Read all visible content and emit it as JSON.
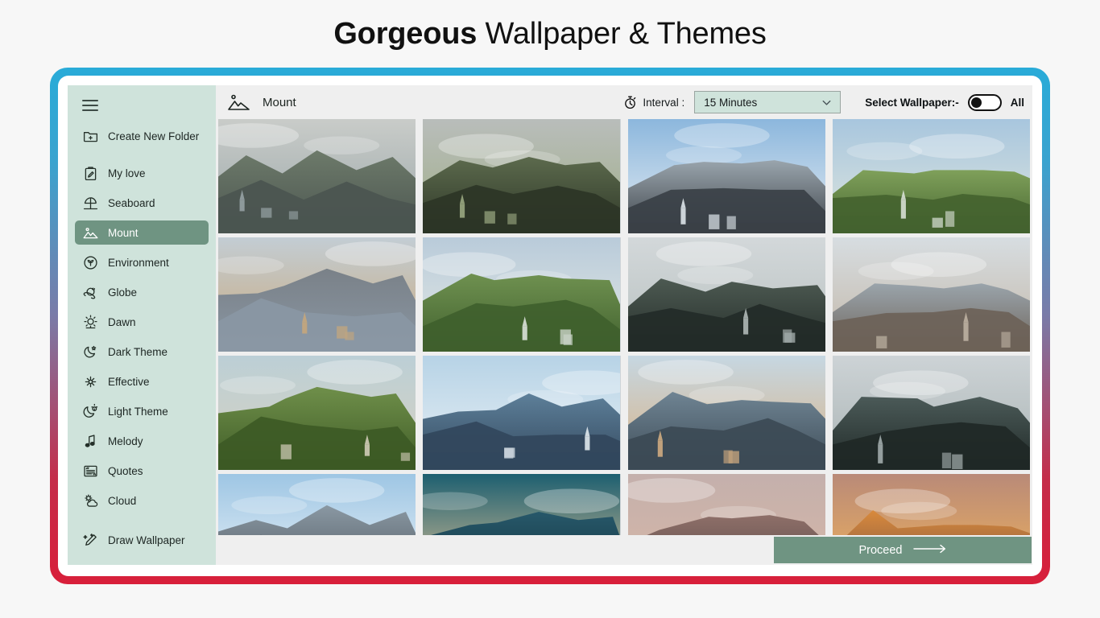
{
  "banner": {
    "title_strong": "Gorgeous",
    "title_light": " Wallpaper & Themes"
  },
  "sidebar": {
    "menu_icon": "hamburger-icon",
    "items": [
      {
        "label": "Create New Folder",
        "icon": "folder-plus-icon",
        "active": false
      },
      {
        "label": "My love",
        "icon": "clipboard-pencil-icon",
        "active": false
      },
      {
        "label": "Seaboard",
        "icon": "beach-umbrella-icon",
        "active": false
      },
      {
        "label": "Mount",
        "icon": "mountain-icon",
        "active": true
      },
      {
        "label": "Environment",
        "icon": "leaf-circle-icon",
        "active": false
      },
      {
        "label": "Globe",
        "icon": "planet-icon",
        "active": false
      },
      {
        "label": "Dawn",
        "icon": "sunrise-icon",
        "active": false
      },
      {
        "label": "Dark Theme",
        "icon": "moon-star-icon",
        "active": false
      },
      {
        "label": "Effective",
        "icon": "flower-icon",
        "active": false
      },
      {
        "label": "Light Theme",
        "icon": "moon-sun-icon",
        "active": false
      },
      {
        "label": "Melody",
        "icon": "music-note-icon",
        "active": false
      },
      {
        "label": "Quotes",
        "icon": "quote-card-icon",
        "active": false
      },
      {
        "label": "Cloud",
        "icon": "cloud-sun-icon",
        "active": false
      },
      {
        "label": "Draw Wallpaper",
        "icon": "pencil-sparkle-icon",
        "active": false
      }
    ]
  },
  "toolbar": {
    "category_icon": "mountain-icon",
    "category_title": "Mount",
    "interval_icon": "stopwatch-icon",
    "interval_label": "Interval :",
    "interval_value": "15 Minutes",
    "interval_chevron": "chevron-down-icon",
    "select_wallpaper_label": "Select Wallpaper:-",
    "toggle_state": "off",
    "toggle_all_label": "All"
  },
  "grid": {
    "tiles": [
      {
        "name": "fjord-ridge-cliffs",
        "sky": "#c9ccc9",
        "mid": "#6d7a6a",
        "fg": "#4b5550",
        "accent": "#9aa6a8"
      },
      {
        "name": "valley-lake-overcast",
        "sky": "#b9bdbb",
        "mid": "#5c6a4d",
        "fg": "#2c3526",
        "accent": "#9fae86"
      },
      {
        "name": "snow-peaks-blue-sky",
        "sky": "#8cb7dd",
        "mid": "#9aa5ad",
        "fg": "#3a4046",
        "accent": "#e6edf2"
      },
      {
        "name": "church-green-foliage",
        "sky": "#a8c6de",
        "mid": "#7fa05a",
        "fg": "#44632f",
        "accent": "#dfe6dd"
      },
      {
        "name": "lakeside-village-dusk",
        "sky": "#c3cdd4",
        "mid": "#7a8188",
        "fg": "#8a97a4",
        "accent": "#c9a87a"
      },
      {
        "name": "church-lake-greens",
        "sky": "#b9cbda",
        "mid": "#6f9150",
        "fg": "#3f5f2d",
        "accent": "#e4e9e4"
      },
      {
        "name": "misty-mountain-village",
        "sky": "#d3d8da",
        "mid": "#4d5a52",
        "fg": "#232b28",
        "accent": "#b7c0bf"
      },
      {
        "name": "snowy-town-hillside",
        "sky": "#d7dde1",
        "mid": "#9aa4ab",
        "fg": "#6d6258",
        "accent": "#c2b6a6"
      },
      {
        "name": "green-valley-farmhouse",
        "sky": "#bccfd6",
        "mid": "#6f8f4a",
        "fg": "#3d5a25",
        "accent": "#d8d2bf"
      },
      {
        "name": "alpine-lake-spire-blue",
        "sky": "#b7d3e6",
        "mid": "#5d7f99",
        "fg": "#32475c",
        "accent": "#e8f0f5"
      },
      {
        "name": "lakeside-church-winter",
        "sky": "#c6d7e2",
        "mid": "#6f8493",
        "fg": "#3c4a55",
        "accent": "#d9b183"
      },
      {
        "name": "foggy-village-dark",
        "sky": "#cdd3d6",
        "mid": "#4b5a58",
        "fg": "#1f2826",
        "accent": "#a9b3b3"
      },
      {
        "name": "snow-ridge-bright",
        "sky": "#9ec6e4",
        "mid": "#8a98a3",
        "fg": "#4a5259",
        "accent": "#eef4f8"
      },
      {
        "name": "teal-sky-spire",
        "sky": "#1d5f70",
        "mid": "#27586a",
        "fg": "#12303a",
        "accent": "#e8c89a"
      },
      {
        "name": "pink-rock-mountain",
        "sky": "#c4b0ac",
        "mid": "#8e6f69",
        "fg": "#4f4440",
        "accent": "#d8b7a6"
      },
      {
        "name": "sunset-orange-clouds",
        "sky": "#b98a78",
        "mid": "#d98a3c",
        "fg": "#6b4a46",
        "accent": "#f4b55a"
      }
    ],
    "proceed_label": "Proceed",
    "proceed_icon": "arrow-right-icon"
  },
  "colors": {
    "frame_top": "#29abd8",
    "frame_bottom": "#d81f3a",
    "sidebar_bg": "#cfe3db",
    "accent_green": "#6f9482",
    "app_bg": "#efefef"
  }
}
